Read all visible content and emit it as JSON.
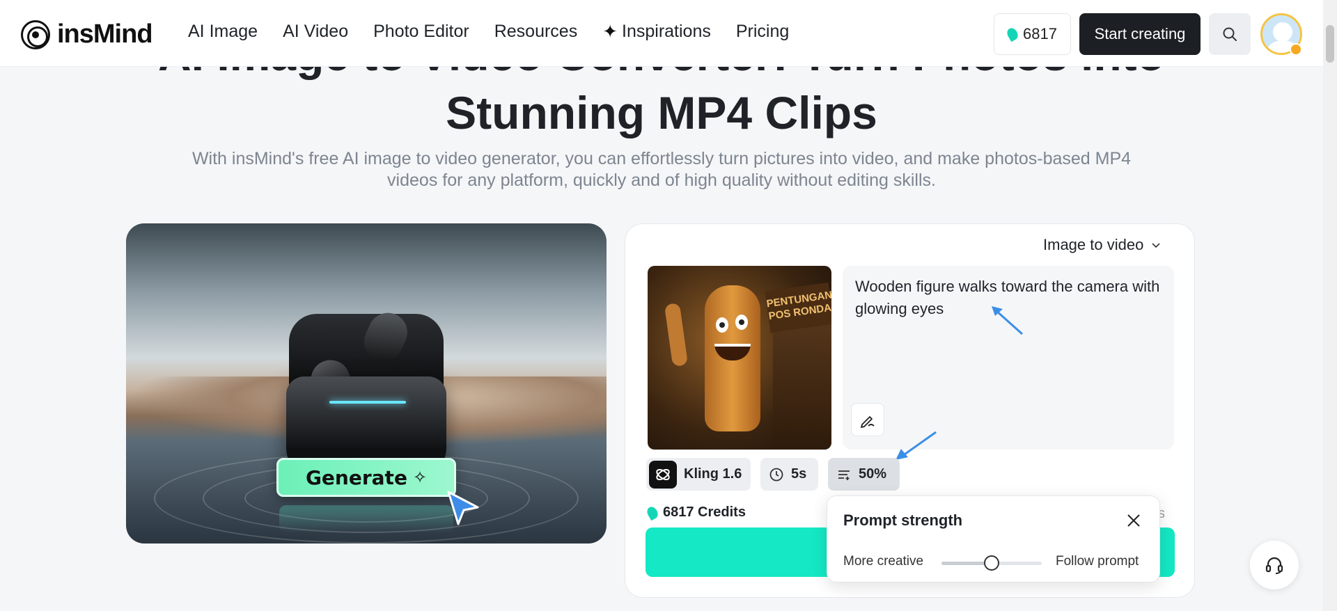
{
  "header": {
    "logo_text": "insMind",
    "nav": [
      "AI Image",
      "AI Video",
      "Photo Editor",
      "Resources",
      "Inspirations",
      "Pricing"
    ],
    "credits": "6817",
    "start_label": "Start creating"
  },
  "hero": {
    "title_line1": "AI Image to Video Converter: Turn Photos into",
    "title_line2": "Stunning MP4 Clips",
    "subtitle_line1": "With insMind's free AI image to video generator, you can effortlessly turn pictures into video, and make photos-based MP4",
    "subtitle_line2": "videos for any platform, quickly and of high quality without editing skills."
  },
  "preview": {
    "generate_label": "Generate"
  },
  "panel": {
    "mode": "Image to video",
    "thumb_sign": "PENTUNGAN POS RONDA",
    "prompt": "Wooden figure walks toward the camera with glowing eyes",
    "model": "Kling 1.6",
    "duration": "5s",
    "strength": "50%",
    "credits_label": "6817 Credits",
    "credits_tail": "its"
  },
  "popup": {
    "title": "Prompt strength",
    "left_label": "More creative",
    "right_label": "Follow prompt",
    "value": 0.5
  },
  "colors": {
    "accent": "#14e8c4",
    "dark": "#1c1f23"
  }
}
